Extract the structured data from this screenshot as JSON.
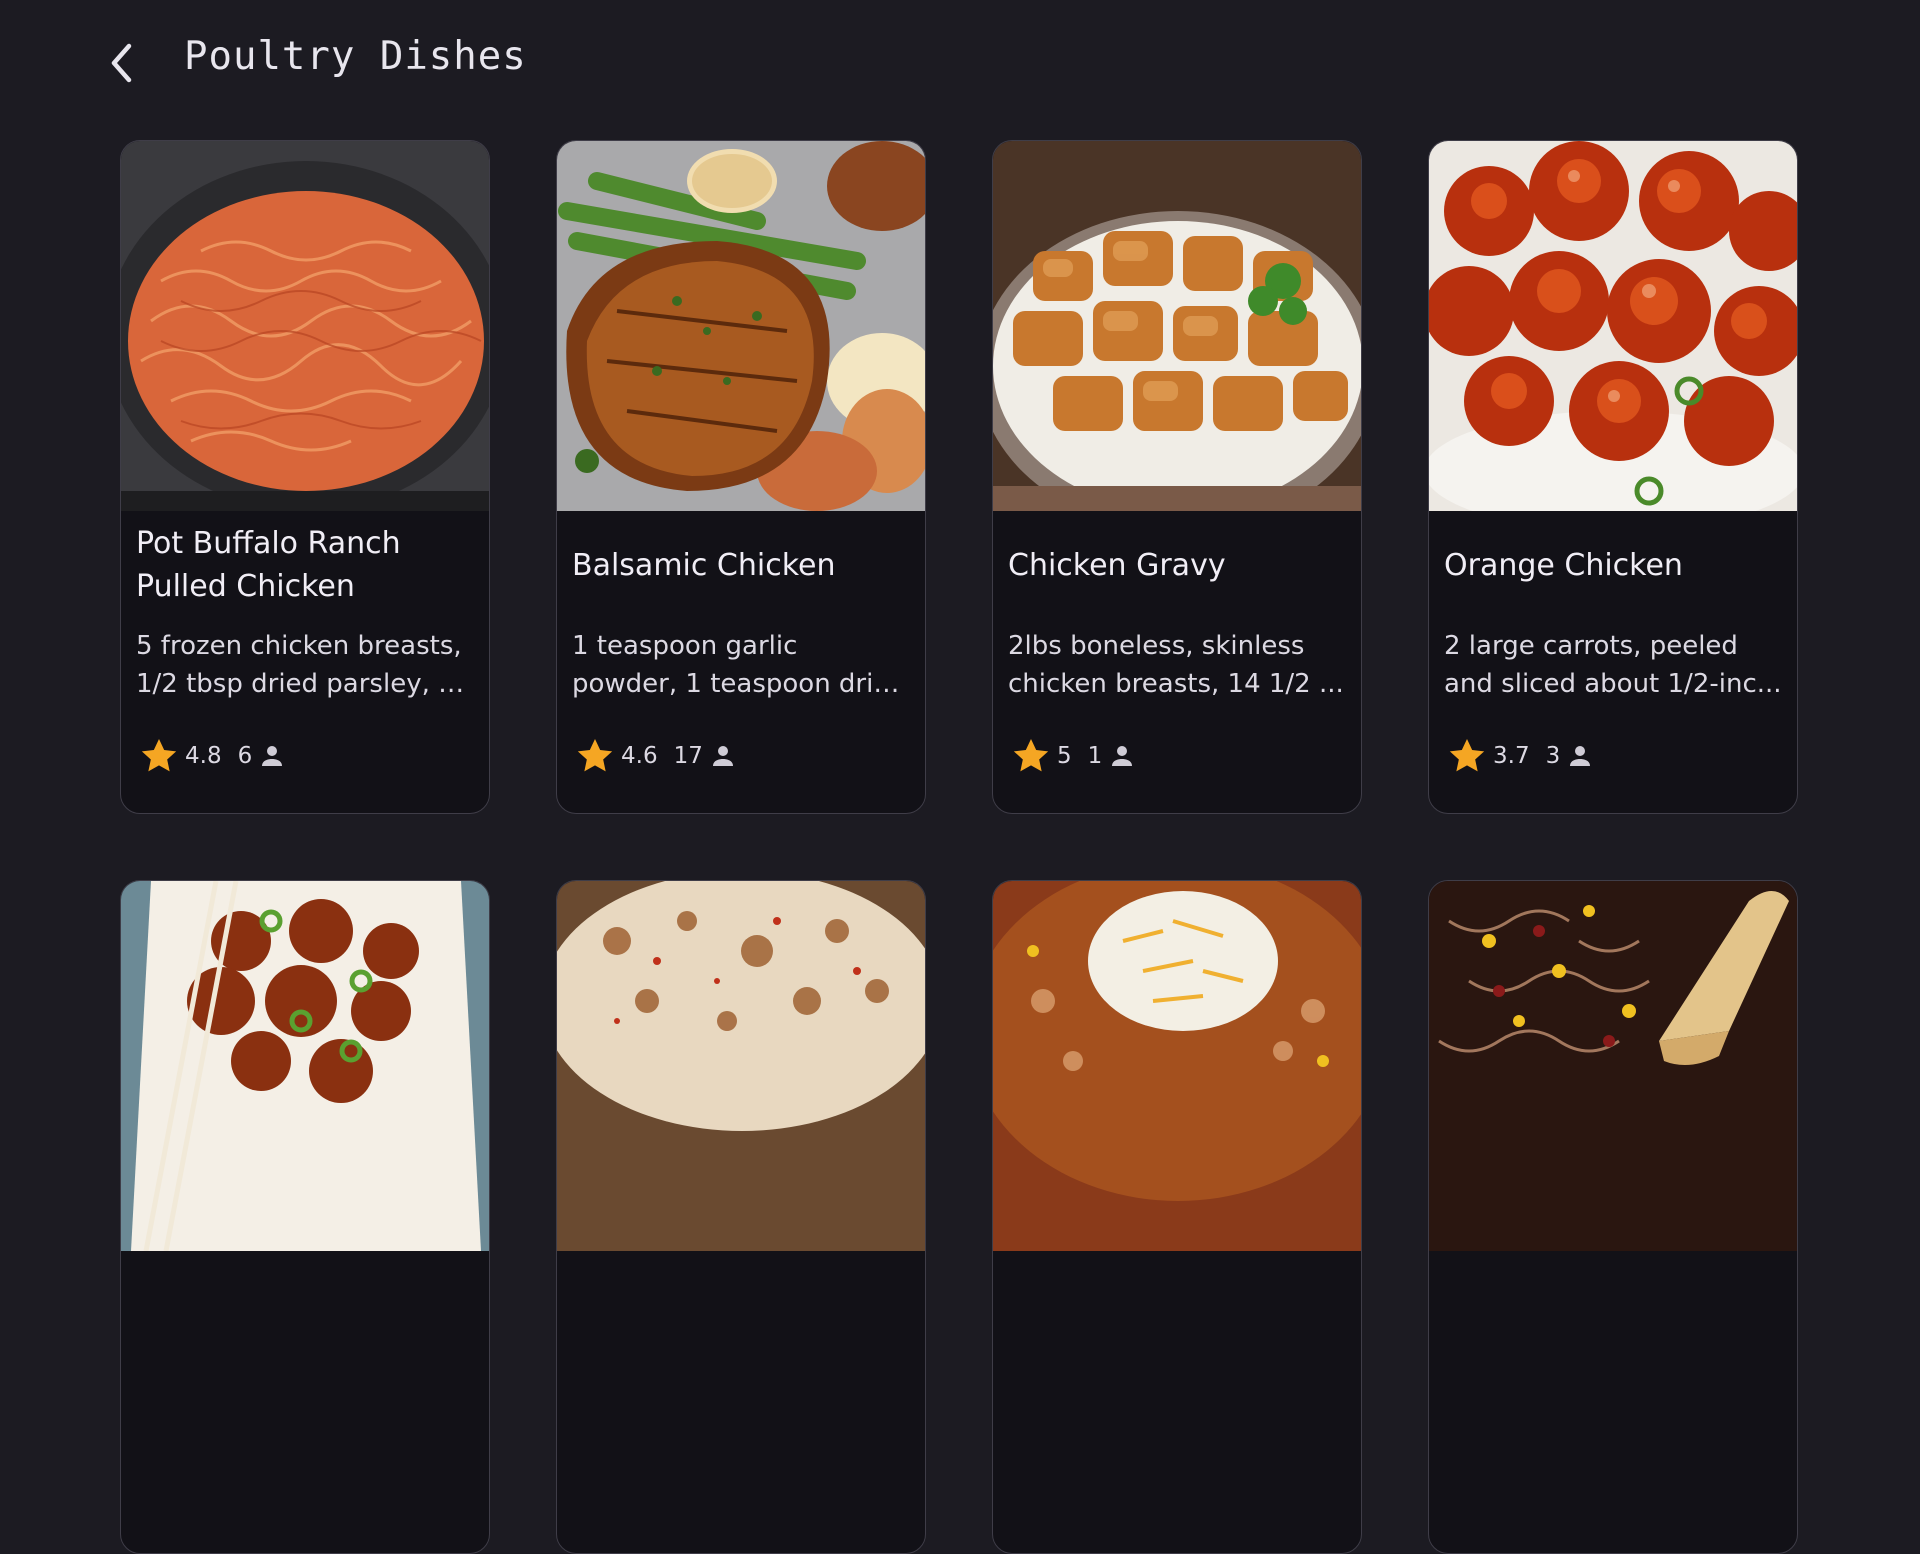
{
  "header": {
    "title": "Poultry Dishes",
    "back_icon": "chevron-left-icon"
  },
  "colors": {
    "background": "#1c1b22",
    "card": "#121117",
    "star": "#f5a623"
  },
  "recipes": [
    {
      "title": "Pot Buffalo Ranch Pulled Chicken",
      "description": "5 frozen chicken breasts, 1/2 tbsp dried parsley, 1 ...",
      "rating": "4.8",
      "count": "6"
    },
    {
      "title": "Balsamic Chicken",
      "description": "1 teaspoon garlic powder, 1 teaspoon dried basil, 1...",
      "rating": "4.6",
      "count": "17"
    },
    {
      "title": "Chicken Gravy",
      "description": "2lbs boneless, skinless chicken breasts, 14 1/2 ...",
      "rating": "5",
      "count": "1"
    },
    {
      "title": "Orange Chicken",
      "description": "2 large carrots, peeled and sliced about 1/2-inc...",
      "rating": "3.7",
      "count": "3"
    },
    {
      "title": "",
      "description": "",
      "rating": "",
      "count": ""
    },
    {
      "title": "",
      "description": "",
      "rating": "",
      "count": ""
    },
    {
      "title": "",
      "description": "",
      "rating": "",
      "count": ""
    },
    {
      "title": "",
      "description": "",
      "rating": "",
      "count": ""
    }
  ]
}
